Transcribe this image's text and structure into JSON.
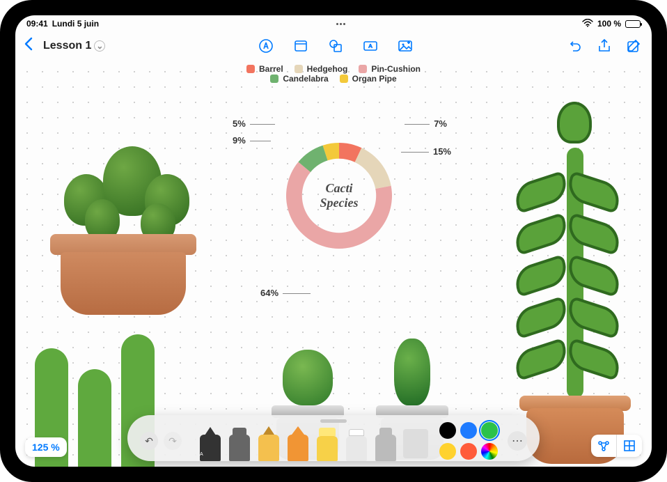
{
  "status": {
    "time": "09:41",
    "date": "Lundi 5 juin",
    "battery_pct": "100 %"
  },
  "toolbar": {
    "board_title": "Lesson 1"
  },
  "zoom": {
    "label": "125 %"
  },
  "chart_data": {
    "type": "pie",
    "title": "Cacti Species",
    "series": [
      {
        "name": "Barrel",
        "value": 7,
        "color": "#f2745f"
      },
      {
        "name": "Hedgehog",
        "value": 15,
        "color": "#e5d6b9"
      },
      {
        "name": "Pin-Cushion",
        "value": 64,
        "color": "#eaa6a6"
      },
      {
        "name": "Candelabra",
        "value": 9,
        "color": "#6fb26f"
      },
      {
        "name": "Organ Pipe",
        "value": 5,
        "color": "#f3c93a"
      }
    ],
    "labels": {
      "p7": "7%",
      "p15": "15%",
      "p64": "64%",
      "p9": "9%",
      "p5": "5%"
    }
  },
  "legend": {
    "row1": [
      {
        "label": "Barrel",
        "color": "#f2745f"
      },
      {
        "label": "Hedgehog",
        "color": "#e5d6b9"
      },
      {
        "label": "Pin-Cushion",
        "color": "#eaa6a6"
      }
    ],
    "row2": [
      {
        "label": "Candelabra",
        "color": "#6fb26f"
      },
      {
        "label": "Organ Pipe",
        "color": "#f3c93a"
      }
    ]
  },
  "palette": {
    "colors": [
      "#000000",
      "#1e7bff",
      "#2bc24a",
      "#ffd22e",
      "#ff5b3a"
    ],
    "selected_index": 2
  }
}
